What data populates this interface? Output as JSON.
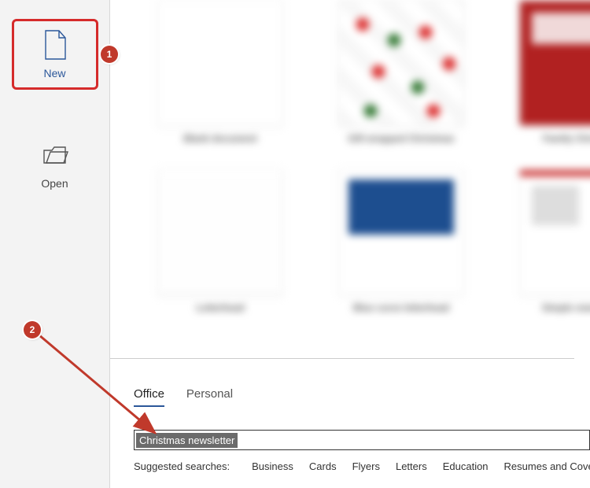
{
  "sidebar": {
    "items": [
      {
        "label": "New"
      },
      {
        "label": "Open"
      }
    ]
  },
  "tabs": {
    "office": "Office",
    "personal": "Personal"
  },
  "search": {
    "value": "Christmas newsletter"
  },
  "suggested": {
    "label": "Suggested searches:",
    "items": [
      "Business",
      "Cards",
      "Flyers",
      "Letters",
      "Education",
      "Resumes and Cover Letters"
    ]
  },
  "callouts": {
    "c1": "1",
    "c2": "2"
  }
}
